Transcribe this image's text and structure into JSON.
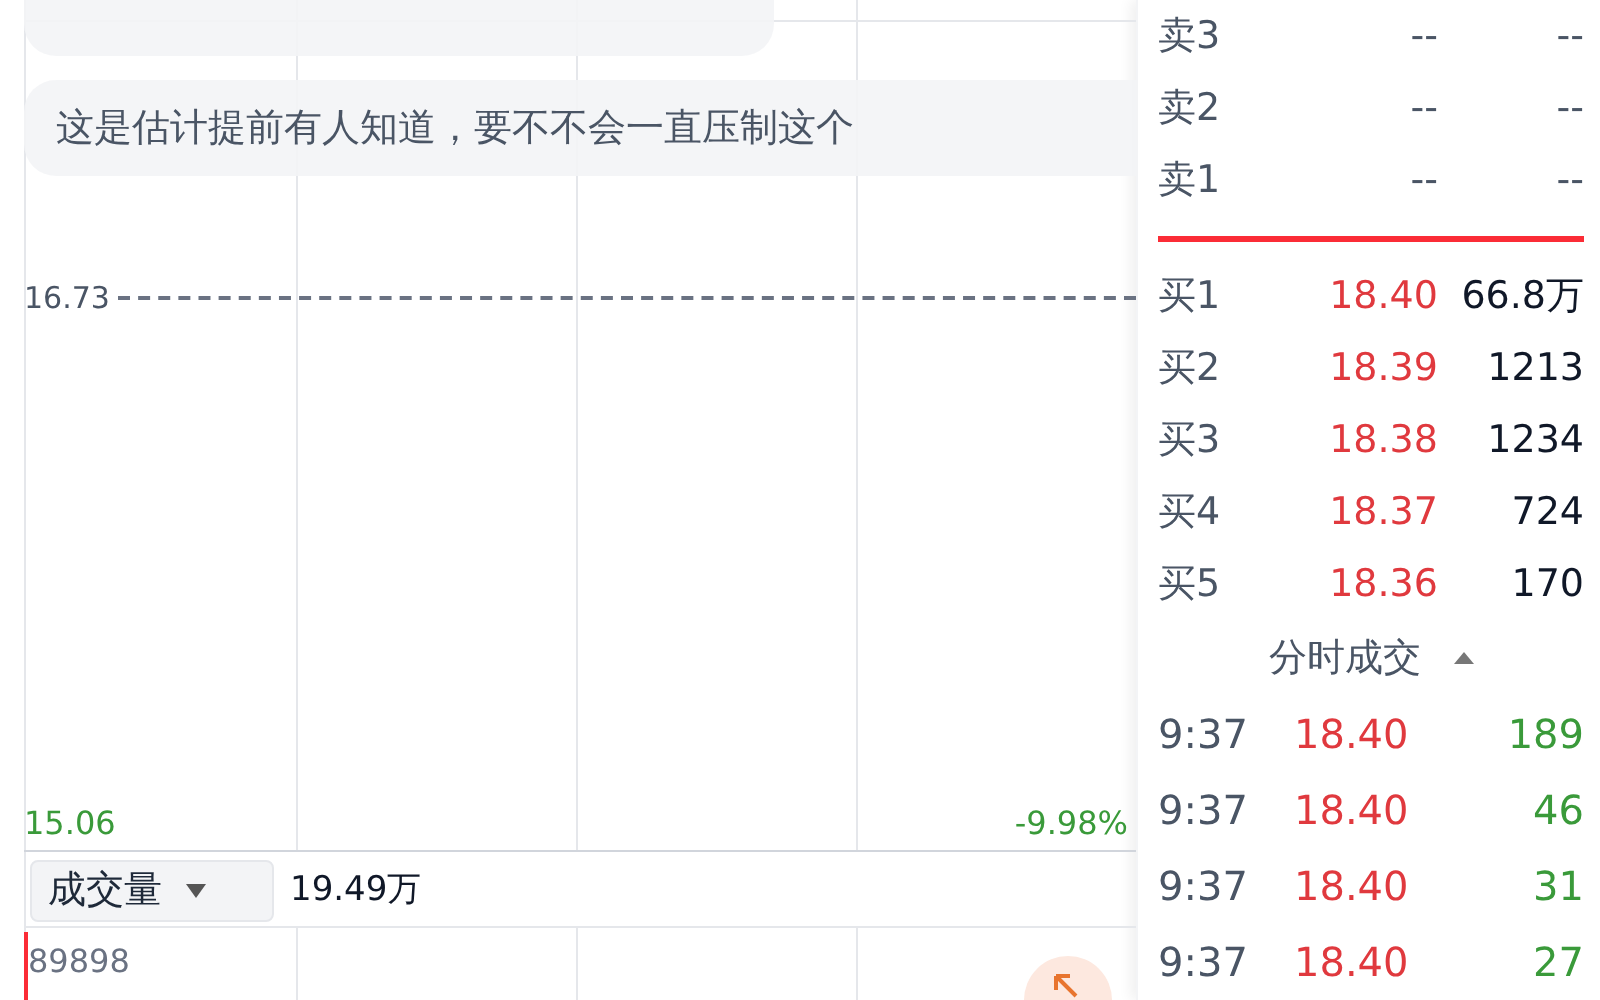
{
  "chat_bubbles": [
    {
      "text": "这是估计提前有人知道，要不不会一直压制这个"
    }
  ],
  "chart": {
    "reference_price": "16.73",
    "low_price": "15.06",
    "low_change": "-9.98%"
  },
  "volume_bar": {
    "selector": "成交量",
    "value": "19.49万",
    "max_volume": "89898"
  },
  "order_book": {
    "asks": [
      {
        "label": "卖3",
        "price": "--",
        "volume": "--"
      },
      {
        "label": "卖2",
        "price": "--",
        "volume": "--"
      },
      {
        "label": "卖1",
        "price": "--",
        "volume": "--"
      }
    ],
    "bids": [
      {
        "label": "买1",
        "price": "18.40",
        "volume": "66.8万"
      },
      {
        "label": "买2",
        "price": "18.39",
        "volume": "1213"
      },
      {
        "label": "买3",
        "price": "18.38",
        "volume": "1234"
      },
      {
        "label": "买4",
        "price": "18.37",
        "volume": "724"
      },
      {
        "label": "买5",
        "price": "18.36",
        "volume": "170"
      }
    ]
  },
  "trades": {
    "title": "分时成交",
    "expanded": false,
    "rows": [
      {
        "time": "9:37",
        "price": "18.40",
        "volume": "189"
      },
      {
        "time": "9:37",
        "price": "18.40",
        "volume": "46"
      },
      {
        "time": "9:37",
        "price": "18.40",
        "volume": "31"
      },
      {
        "time": "9:37",
        "price": "18.40",
        "volume": "27"
      }
    ]
  }
}
